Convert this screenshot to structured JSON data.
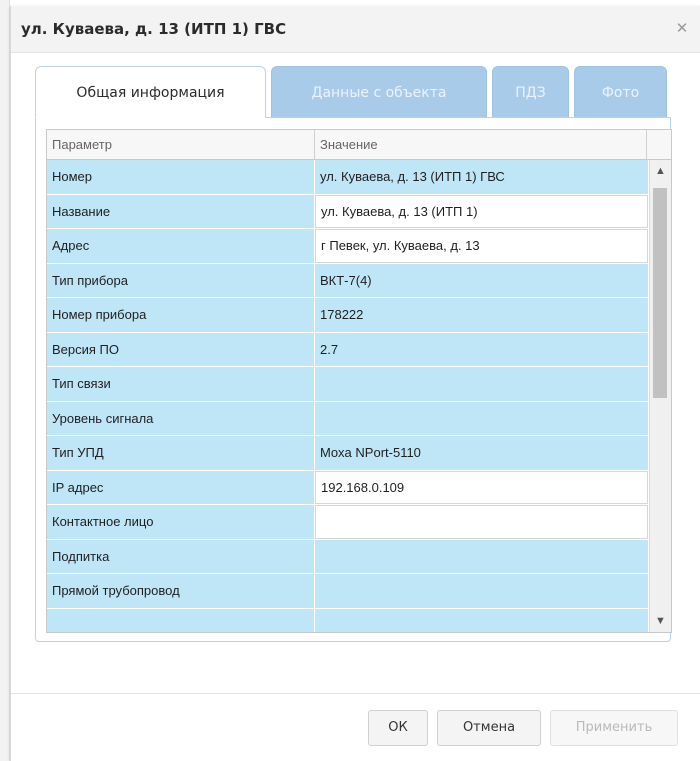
{
  "dialog": {
    "title": "ул. Куваева, д. 13 (ИТП 1) ГВС",
    "close_glyph": "✕"
  },
  "tabs": [
    {
      "label": "Общая информация",
      "active": true
    },
    {
      "label": "Данные с объекта",
      "active": false
    },
    {
      "label": "ПДЗ",
      "active": false
    },
    {
      "label": "Фото",
      "active": false
    }
  ],
  "grid": {
    "headers": {
      "param": "Параметр",
      "value": "Значение"
    },
    "rows": [
      {
        "param": "Номер",
        "value": "ул. Куваева, д. 13 (ИТП 1) ГВС",
        "editable": false
      },
      {
        "param": "Название",
        "value": "ул. Куваева, д. 13 (ИТП 1)",
        "editable": true
      },
      {
        "param": "Адрес",
        "value": "г Певек, ул. Куваева, д. 13",
        "editable": true
      },
      {
        "param": "Тип прибора",
        "value": "ВКТ-7(4)",
        "editable": false
      },
      {
        "param": "Номер прибора",
        "value": "178222",
        "editable": false
      },
      {
        "param": "Версия ПО",
        "value": "2.7",
        "editable": false
      },
      {
        "param": "Тип связи",
        "value": "",
        "editable": false
      },
      {
        "param": "Уровень сигнала",
        "value": "",
        "editable": false
      },
      {
        "param": "Тип УПД",
        "value": "Moxa NPort-5110",
        "editable": false
      },
      {
        "param": "IP адрес",
        "value": "192.168.0.109",
        "editable": true
      },
      {
        "param": "Контактное лицо",
        "value": "",
        "editable": true
      },
      {
        "param": "Подпитка",
        "value": "",
        "editable": false
      },
      {
        "param": "Прямой трубопровод",
        "value": "",
        "editable": false
      },
      {
        "param": "",
        "value": "",
        "editable": false
      }
    ],
    "scroll_up_glyph": "▲",
    "scroll_down_glyph": "▼"
  },
  "buttons": {
    "ok": "ОК",
    "cancel": "Отмена",
    "apply": "Применить"
  },
  "colors": {
    "row_bg": "#bfe6f7",
    "tab_inactive_bg": "#a9cbea",
    "accent_border": "#bcd3e6"
  }
}
